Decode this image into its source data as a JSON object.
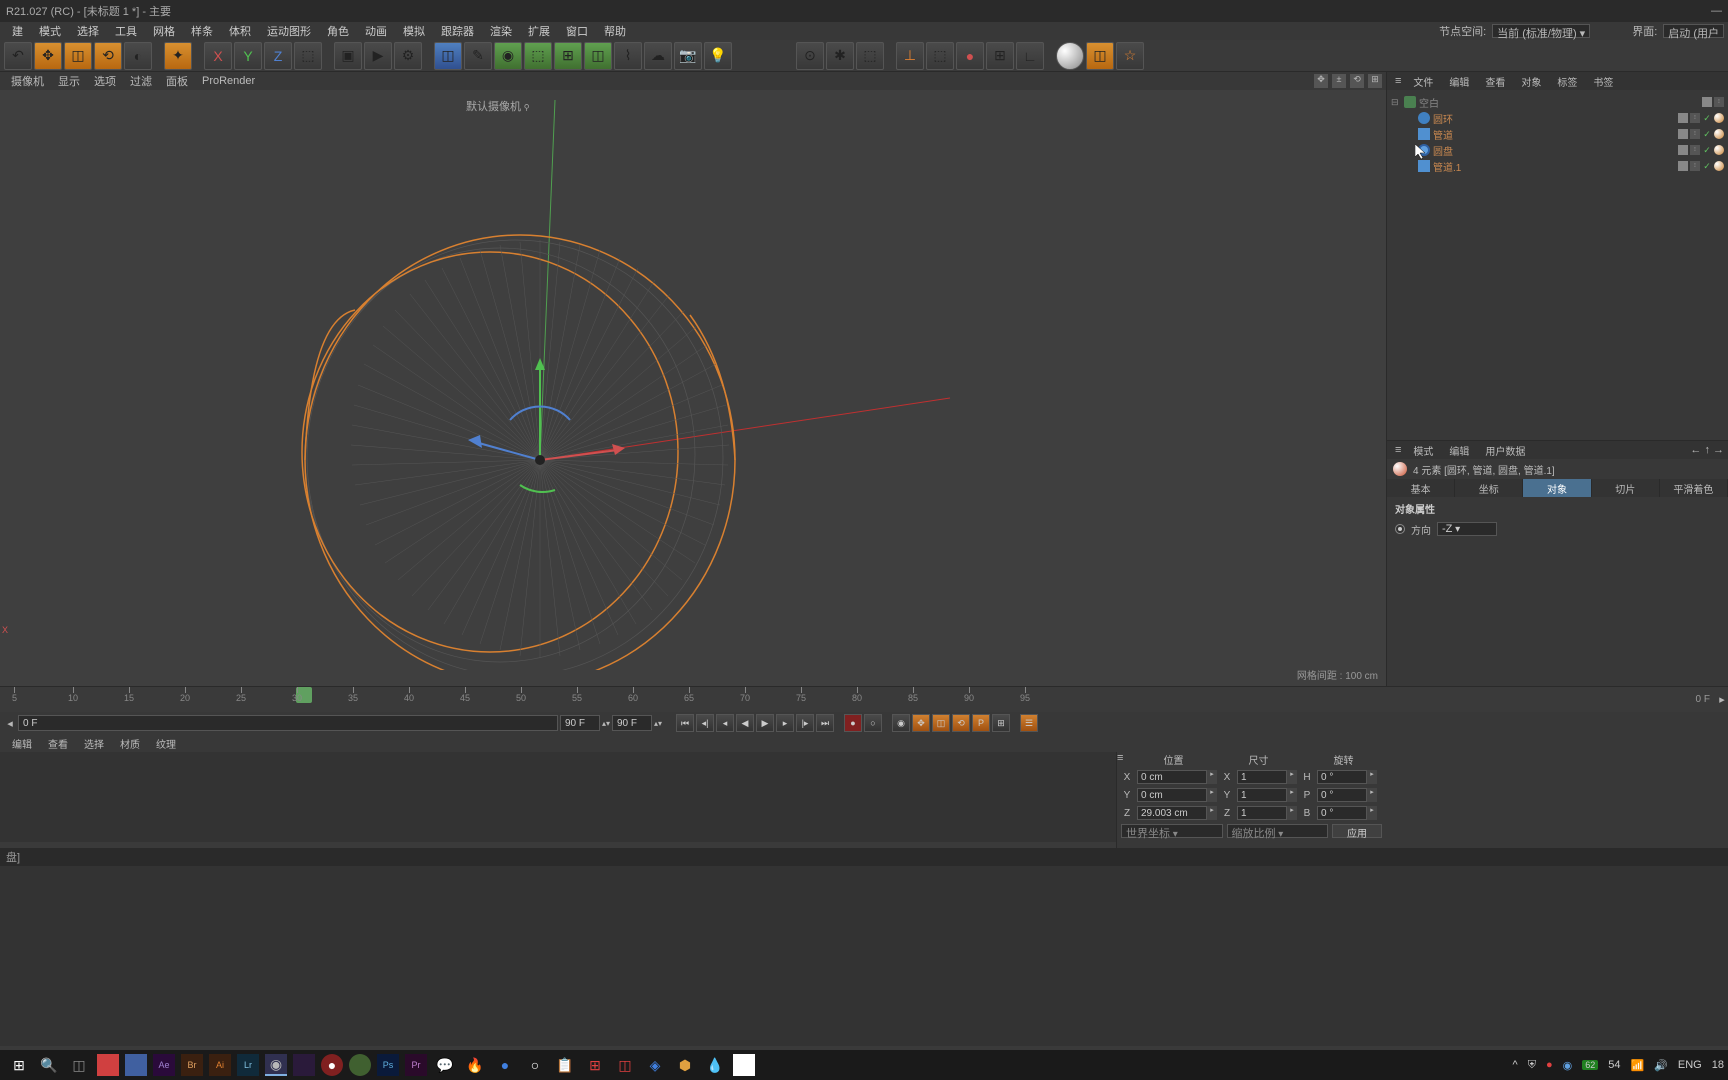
{
  "titlebar": {
    "title": "R21.027 (RC) - [未标题 1 *] - 主要"
  },
  "menubar": {
    "items": [
      "建",
      "模式",
      "选择",
      "工具",
      "网格",
      "样条",
      "体积",
      "运动图形",
      "角色",
      "动画",
      "模拟",
      "跟踪器",
      "渲染",
      "扩展",
      "窗口",
      "帮助"
    ],
    "rightLabel1": "节点空间:",
    "rightVal1": "当前 (标准/物理)",
    "rightLabel2": "界面:",
    "rightVal2": "启动 (用户"
  },
  "viewport": {
    "tabs": [
      "摄像机",
      "显示",
      "选项",
      "过滤",
      "面板",
      "ProRender"
    ],
    "camera": "默认摄像机",
    "gridLabel": "网格间距 : 100 cm",
    "axisX": "X"
  },
  "objectPanel": {
    "tabs": [
      "文件",
      "编辑",
      "查看",
      "对象",
      "标签",
      "书签"
    ],
    "tree": {
      "root": "空白",
      "children": [
        {
          "name": "圆环",
          "type": "torus"
        },
        {
          "name": "管道",
          "type": "tube"
        },
        {
          "name": "圆盘",
          "type": "disc"
        },
        {
          "name": "管道.1",
          "type": "tube"
        }
      ]
    }
  },
  "attrPanel": {
    "tabs": [
      "模式",
      "编辑",
      "用户数据"
    ],
    "title": "4 元素 [圆环, 管道, 圆盘, 管道.1]",
    "subTabs": [
      "基本",
      "坐标",
      "对象",
      "切片",
      "平滑着色"
    ],
    "activeTab": 2,
    "sectionTitle": "对象属性",
    "rows": [
      {
        "label": "方向",
        "value": "-Z"
      }
    ]
  },
  "timeline": {
    "start": 5,
    "end": 95,
    "endFrame": "0 F",
    "ticks": [
      5,
      10,
      15,
      20,
      25,
      30,
      35,
      40,
      45,
      50,
      55,
      60,
      65,
      70,
      75,
      80,
      85,
      90,
      95
    ],
    "currentFrame": "0 F",
    "totalFrame": "90 F",
    "totalFrame2": "90 F"
  },
  "materialsBar": {
    "tabs": [
      "编辑",
      "查看",
      "选择",
      "材质",
      "纹理"
    ]
  },
  "coord": {
    "headers": [
      "位置",
      "尺寸",
      "旋转"
    ],
    "rows": [
      {
        "axis": "X",
        "pos": "0 cm",
        "sizeAxis": "X",
        "size": "1",
        "rotAxis": "H",
        "rot": "0 °"
      },
      {
        "axis": "Y",
        "pos": "0 cm",
        "sizeAxis": "Y",
        "size": "1",
        "rotAxis": "P",
        "rot": "0 °"
      },
      {
        "axis": "Z",
        "pos": "29.003 cm",
        "sizeAxis": "Z",
        "size": "1",
        "rotAxis": "B",
        "rot": "0 °"
      }
    ],
    "footer": {
      "sel1": "世界坐标",
      "sel2": "缩放比例",
      "btn": "应用"
    }
  },
  "statusbar": {
    "text": "盘]"
  },
  "systray": {
    "val1": "62",
    "val2": "54",
    "lang": "ENG",
    "date": "18"
  }
}
